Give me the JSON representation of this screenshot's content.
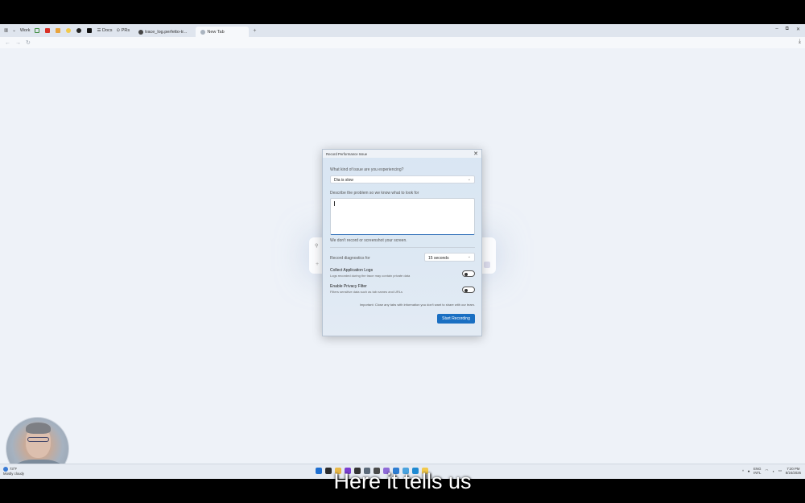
{
  "browser": {
    "profile_label": "Work",
    "tabs": [
      {
        "label": "Docs"
      },
      {
        "label": "PRs"
      },
      {
        "label": "trace_log.perfetto-tr..."
      },
      {
        "label": "New Tab"
      }
    ],
    "new_tab_symbol": "+",
    "window_controls": [
      "–",
      "⧉",
      "✕"
    ],
    "nav": {
      "back": "←",
      "forward": "→",
      "reload": "↻",
      "download": "⤓"
    }
  },
  "search_pill": {
    "search_symbol": "⚲",
    "plus_symbol": "+"
  },
  "dialog": {
    "title": "Record Performance Issue",
    "close_symbol": "✕",
    "issue_question": "What kind of issue are you experiencing?",
    "issue_value": "Dia is slow",
    "describe_label": "Describe the problem so we know what to look for",
    "describe_value": "",
    "privacy_note": "We don't record or screenshot your screen.",
    "record_label": "Record diagnostics for",
    "duration_value": "15 seconds",
    "collect_logs_label": "Collect Application Logs",
    "collect_logs_sub": "Logs recorded during the trace may contain private data",
    "collect_logs_on": false,
    "privacy_filter_label": "Enable Privacy Filter",
    "privacy_filter_sub": "Filters sensitive data such as tab names and URLs",
    "privacy_filter_on": false,
    "important_note": "Important: Close any tabs with information you don't want to share with our team.",
    "start_button": "Start Recording",
    "chevron": "⌄"
  },
  "taskbar": {
    "weather_temp": "73°F",
    "weather_desc": "Mostly cloudy",
    "lang_top": "ENG",
    "lang_bottom": "INTL",
    "time": "7:20 PM",
    "date": "8/24/2026",
    "tray_arrow": "^"
  },
  "caption": "Here it tells us",
  "colors": {
    "accent": "#1a6fc2",
    "dialog_bg": "#dde8f3",
    "page_bg": "#eef2f8"
  }
}
